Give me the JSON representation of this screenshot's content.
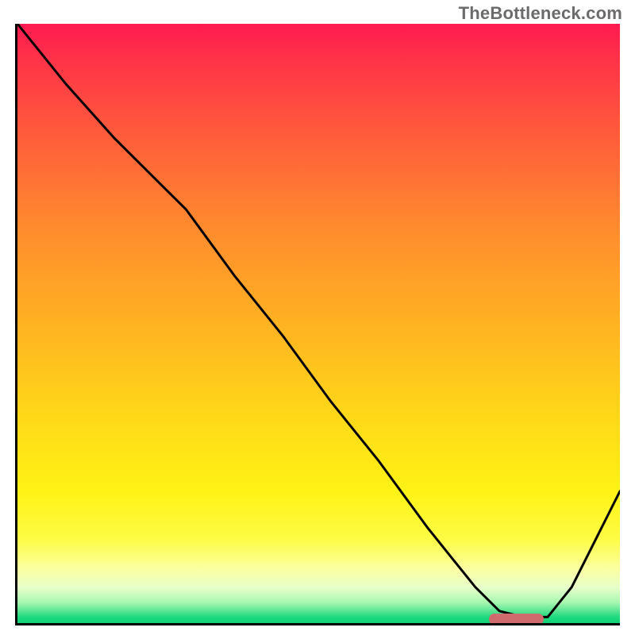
{
  "watermark": "TheBottleneck.com",
  "colors": {
    "axis": "#000000",
    "curve": "#000000",
    "marker": "#cf6b6c",
    "gradient_top": "#ff1a51",
    "gradient_bottom": "#11d276"
  },
  "chart_data": {
    "type": "line",
    "title": "",
    "xlabel": "",
    "ylabel": "",
    "xlim": [
      0,
      100
    ],
    "ylim": [
      0,
      100
    ],
    "x": [
      0,
      8,
      16,
      24,
      28,
      36,
      44,
      52,
      60,
      68,
      72,
      76,
      80,
      84,
      88,
      92,
      96,
      100
    ],
    "values": [
      100,
      90,
      81,
      73,
      69,
      58,
      48,
      37,
      27,
      16,
      11,
      6,
      2,
      1,
      1,
      6,
      14,
      22
    ],
    "marker": {
      "x_start": 78,
      "x_end": 87,
      "y": 1
    },
    "annotations": []
  }
}
